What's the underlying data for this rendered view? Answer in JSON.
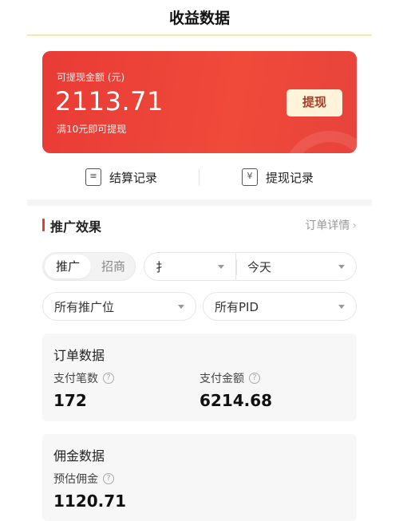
{
  "header": {
    "title": "收益数据"
  },
  "balance_card": {
    "label": "可提现金额 (元)",
    "amount": "2113.71",
    "hint": "满10元即可提现",
    "withdraw_button": "提现"
  },
  "records": {
    "settlement": "结算记录",
    "withdrawal": "提现记录"
  },
  "promotion": {
    "title": "推广效果",
    "detail_link": "订单详情"
  },
  "toggle": {
    "active": "推广",
    "inactive": "招商"
  },
  "filters": {
    "source_select": "扌",
    "date_select": "今天",
    "position_select": "所有推广位",
    "pid_select": "所有PID"
  },
  "order_data": {
    "title": "订单数据",
    "pay_count_label": "支付笔数",
    "pay_count_value": "172",
    "pay_amount_label": "支付金额",
    "pay_amount_value": "6214.68"
  },
  "commission_data": {
    "title": "佣金数据",
    "estimated_label": "预估佣金",
    "estimated_value": "1120.71"
  },
  "colors": {
    "accent_red": "#e83b36",
    "button_bg": "#fff3d9"
  }
}
